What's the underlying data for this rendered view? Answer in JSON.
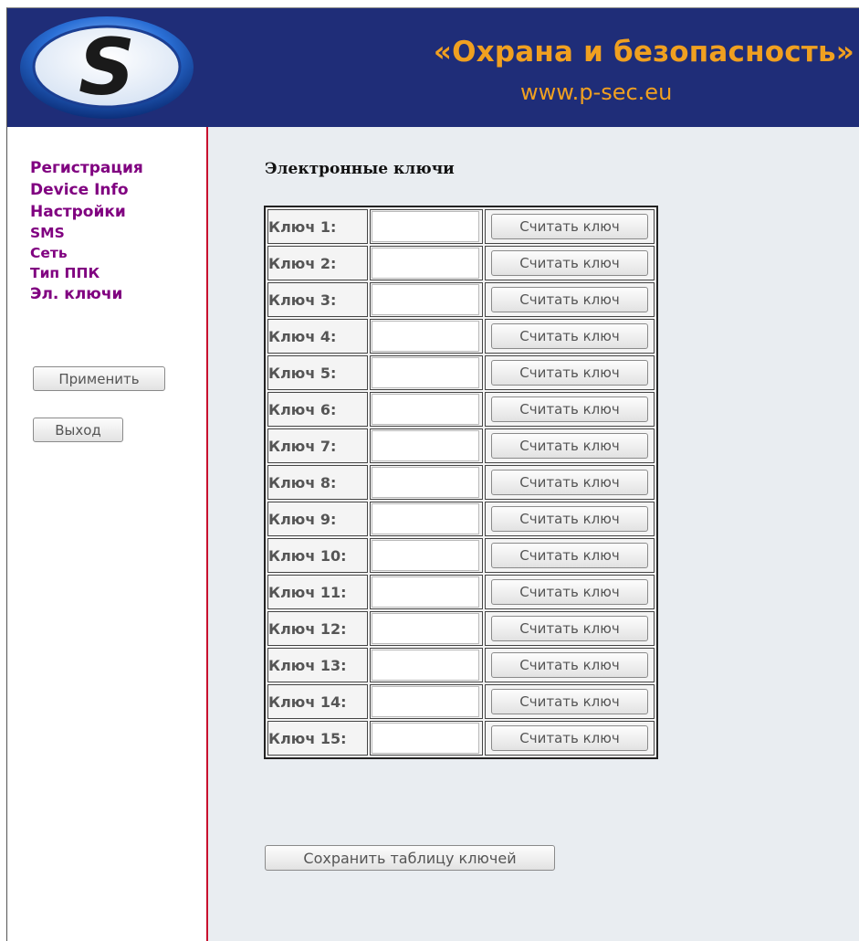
{
  "header": {
    "logo_letter": "S",
    "title": "«Охрана и безопасность»",
    "url": "www.p-sec.eu"
  },
  "sidebar": {
    "items": [
      {
        "label": "Регистрация"
      },
      {
        "label": "Device Info"
      },
      {
        "label": "Настройки"
      },
      {
        "label": "SMS"
      },
      {
        "label": "Сеть"
      },
      {
        "label": "Тип ППК"
      },
      {
        "label": "Эл. ключи"
      }
    ],
    "apply_label": "Применить",
    "exit_label": "Выход"
  },
  "main": {
    "title": "Электронные ключи",
    "read_label": "Считать ключ",
    "save_label": "Сохранить таблицу ключей",
    "keys": [
      {
        "label": "Ключ 1:",
        "value": ""
      },
      {
        "label": "Ключ 2:",
        "value": ""
      },
      {
        "label": "Ключ 3:",
        "value": ""
      },
      {
        "label": "Ключ 4:",
        "value": ""
      },
      {
        "label": "Ключ 5:",
        "value": ""
      },
      {
        "label": "Ключ 6:",
        "value": ""
      },
      {
        "label": "Ключ 7:",
        "value": ""
      },
      {
        "label": "Ключ 8:",
        "value": ""
      },
      {
        "label": "Ключ 9:",
        "value": ""
      },
      {
        "label": "Ключ 10:",
        "value": ""
      },
      {
        "label": "Ключ 11:",
        "value": ""
      },
      {
        "label": "Ключ 12:",
        "value": ""
      },
      {
        "label": "Ключ 13:",
        "value": ""
      },
      {
        "label": "Ключ 14:",
        "value": ""
      },
      {
        "label": "Ключ 15:",
        "value": ""
      }
    ]
  },
  "colors": {
    "header_bg": "#1f2d78",
    "brand_accent": "#f0a020",
    "nav_link": "#800080",
    "sidebar_divider": "#c8102e",
    "main_bg": "#e9edf1"
  }
}
